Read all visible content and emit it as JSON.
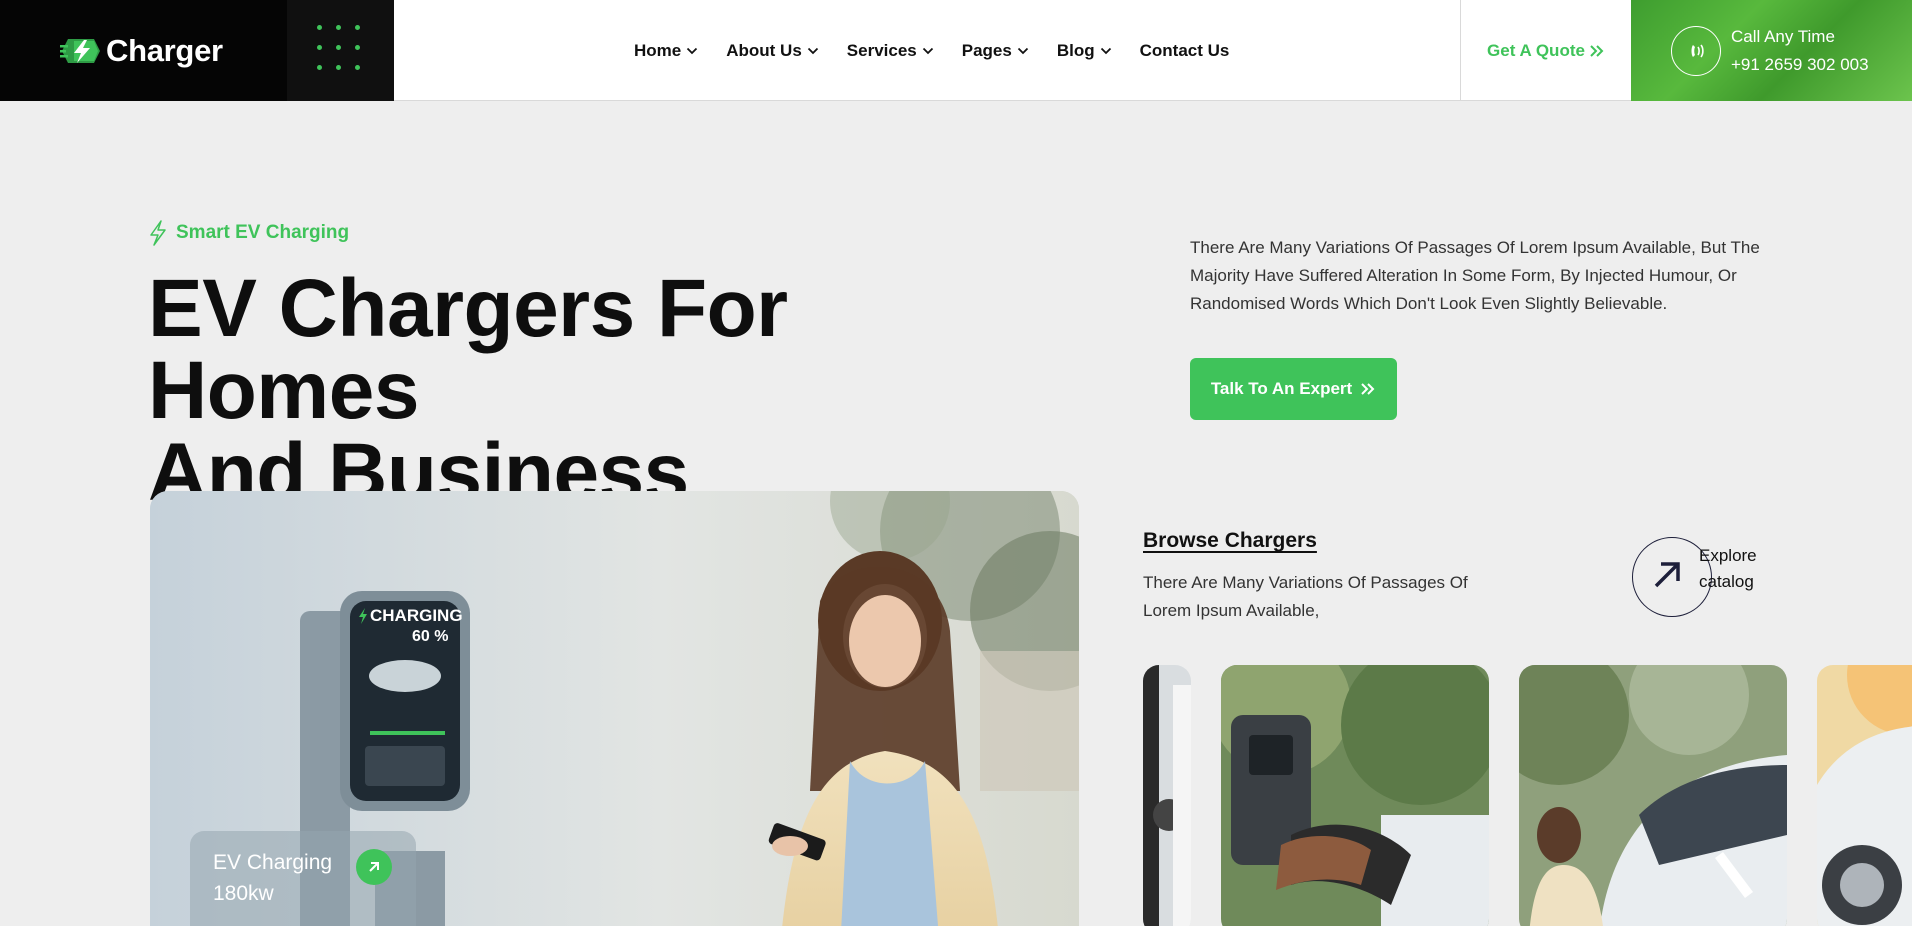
{
  "brand": {
    "name": "Charger",
    "accent": "#3fc35a"
  },
  "nav": {
    "items": [
      {
        "label": "Home",
        "dropdown": true
      },
      {
        "label": "About Us",
        "dropdown": true
      },
      {
        "label": "Services",
        "dropdown": true
      },
      {
        "label": "Pages",
        "dropdown": true
      },
      {
        "label": "Blog",
        "dropdown": true
      },
      {
        "label": "Contact Us",
        "dropdown": false
      }
    ]
  },
  "header": {
    "quote_label": "Get A Quote",
    "call_label": "Call Any Time",
    "call_number": "+91 2659 302 003"
  },
  "hero": {
    "tagline": "Smart EV Charging",
    "title_line1": "EV Chargers For Homes",
    "title_line2": "And Business",
    "description": "There Are Many Variations Of Passages Of Lorem Ipsum Available, But The Majority Have Suffered Alteration In Some Form, By Injected Humour, Or Randomised Words Which Don't Look Even Slightly Believable.",
    "cta_label": "Talk To An Expert"
  },
  "photo_card": {
    "line1": "EV Charging",
    "line2": "180kw"
  },
  "charger_screen": {
    "label": "CHARGING",
    "percent": "60 %"
  },
  "browse": {
    "title": "Browse Chargers",
    "description": "There Are Many Variations Of Passages Of Lorem Ipsum Available,",
    "explore_line1": "Explore",
    "explore_line2": "catalog"
  }
}
